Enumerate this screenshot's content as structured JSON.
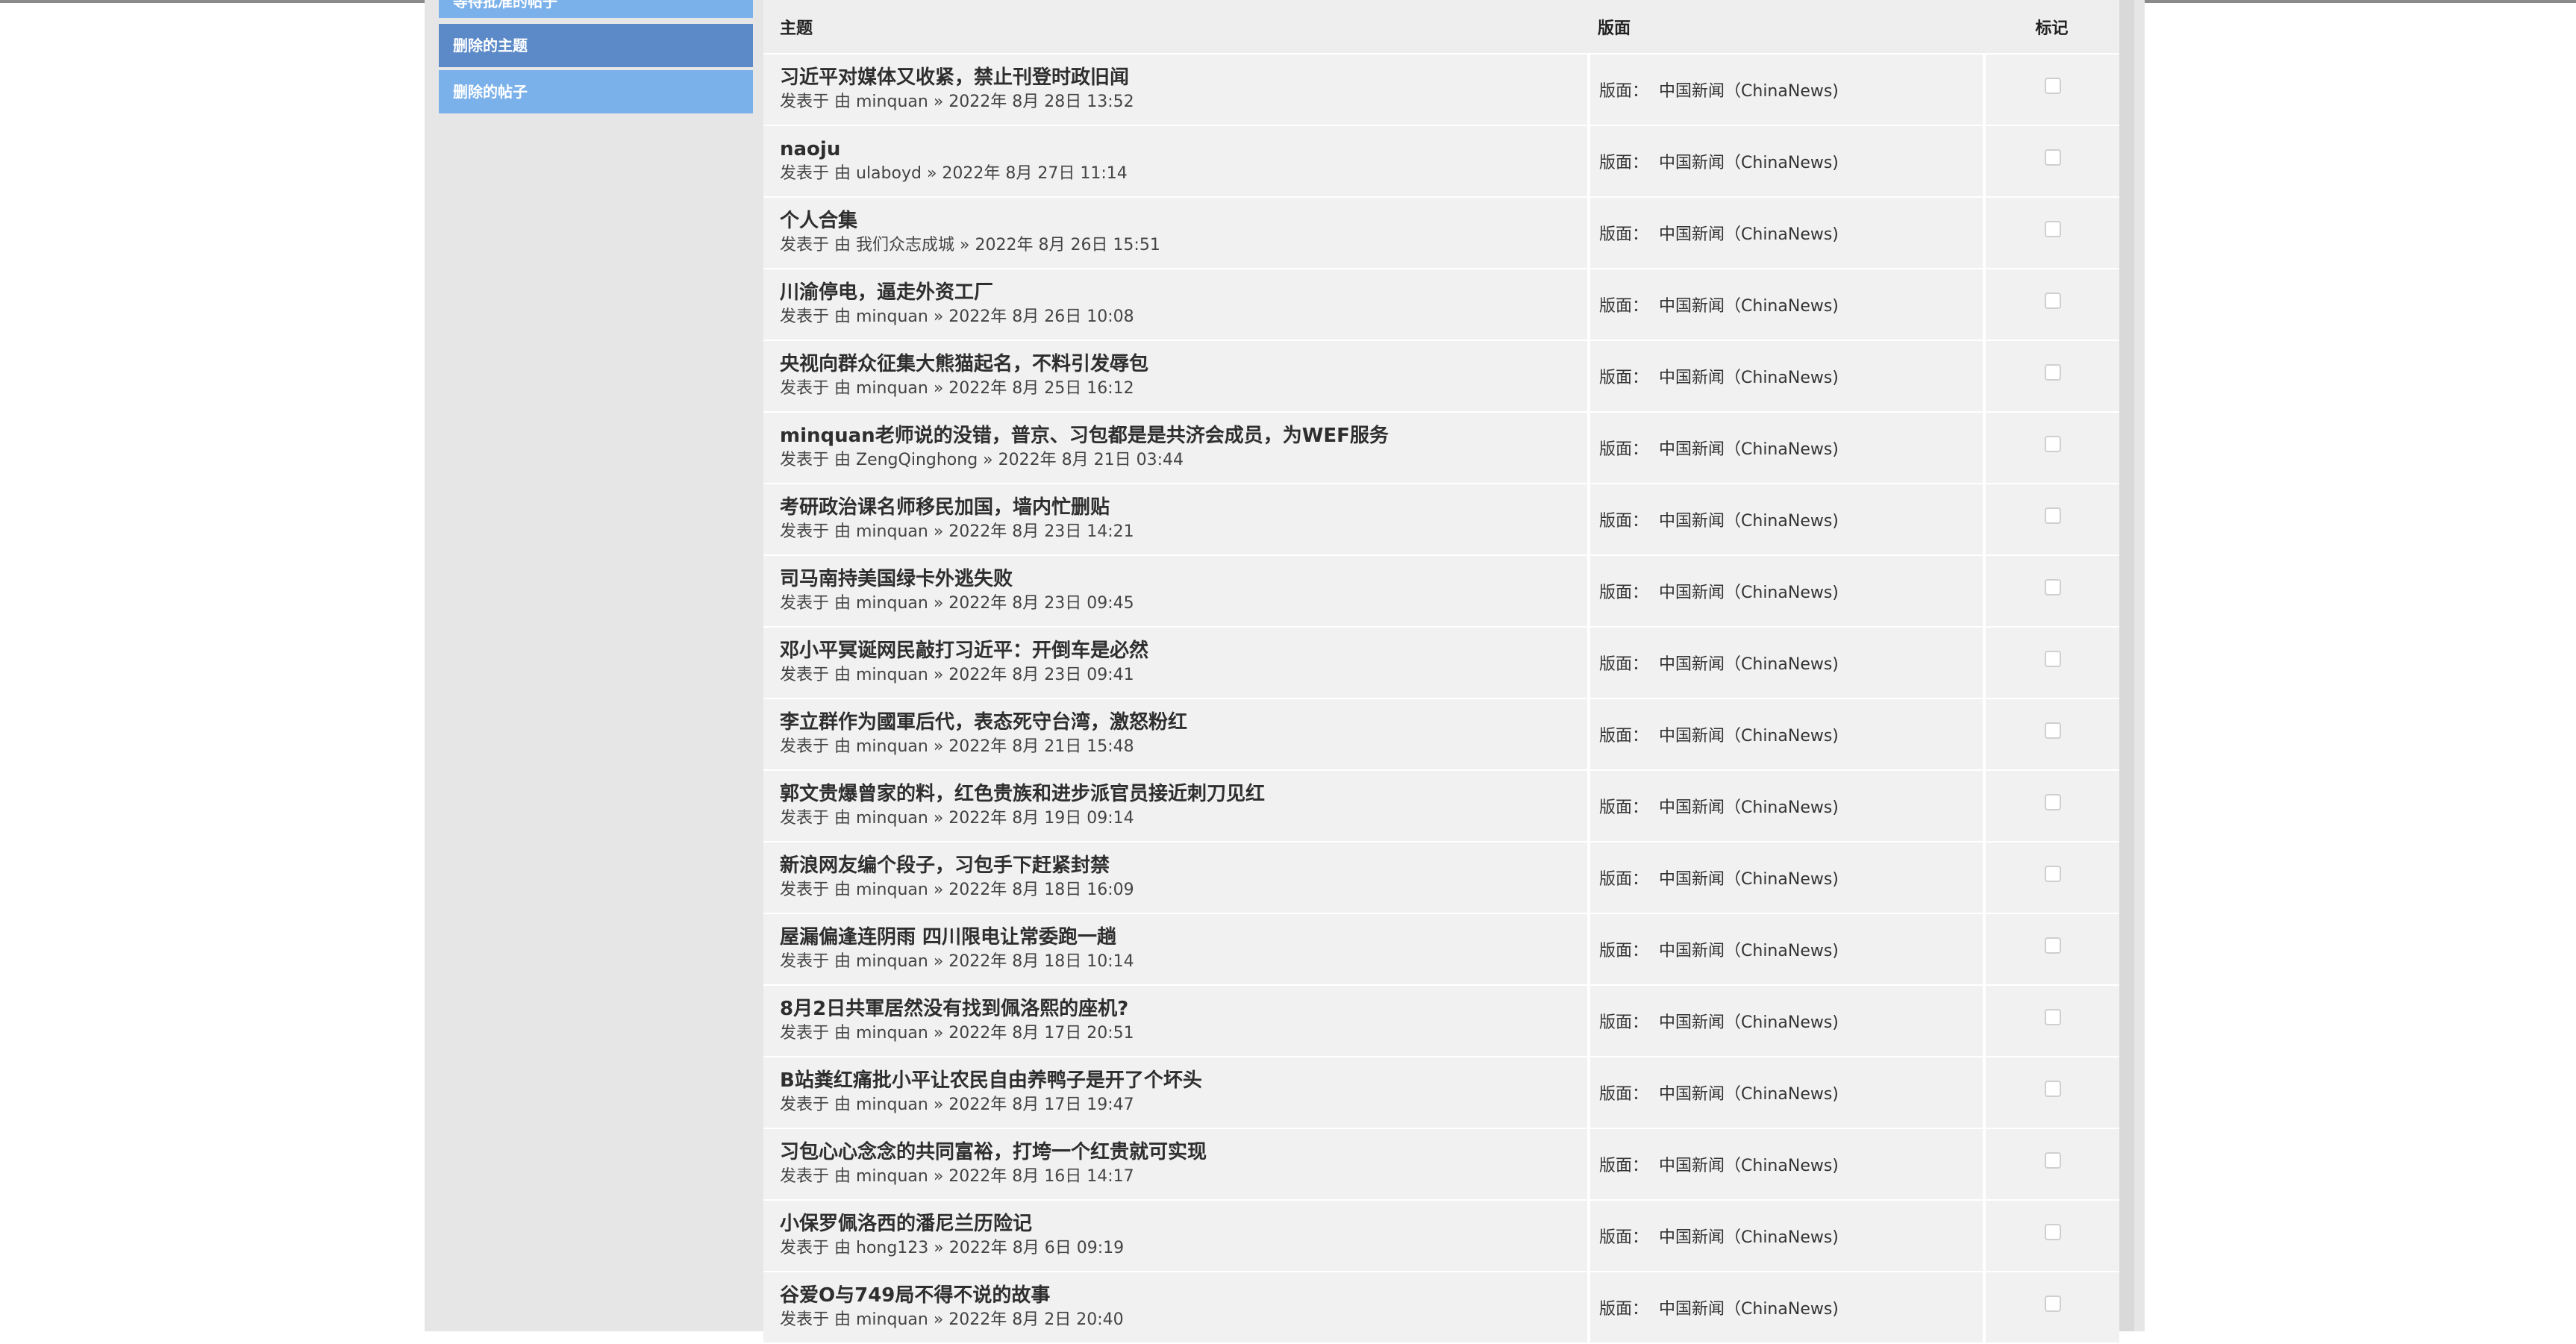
{
  "sidebar": {
    "items": [
      {
        "label": "等待批准的帖子",
        "state": "partial"
      },
      {
        "label": "删除的主题",
        "state": "active"
      },
      {
        "label": "删除的帖子",
        "state": "normal"
      }
    ]
  },
  "table": {
    "headers": {
      "topic": "主题",
      "forum": "版面",
      "mark": "标记"
    },
    "forum_label": "版面：",
    "meta_prefix": "发表于 由",
    "rows": [
      {
        "title": "习近平对媒体又收紧，禁止刊登时政旧闻",
        "author": "minquan",
        "date": "2022年 8月 28日 13:52",
        "forum": "中国新闻（ChinaNews)"
      },
      {
        "title": "naoju",
        "author": "ulaboyd",
        "date": "2022年 8月 27日 11:14",
        "forum": "中国新闻（ChinaNews)"
      },
      {
        "title": "个人合集",
        "author": "我们众志成城",
        "date": "2022年 8月 26日 15:51",
        "forum": "中国新闻（ChinaNews)"
      },
      {
        "title": "川渝停电，逼走外资工厂",
        "author": "minquan",
        "date": "2022年 8月 26日 10:08",
        "forum": "中国新闻（ChinaNews)"
      },
      {
        "title": "央视向群众征集大熊猫起名，不料引发辱包",
        "author": "minquan",
        "date": "2022年 8月 25日 16:12",
        "forum": "中国新闻（ChinaNews)"
      },
      {
        "title": "minquan老师说的没错，普京、习包都是是共济会成员，为WEF服务",
        "author": "ZengQinghong",
        "date": "2022年 8月 21日 03:44",
        "forum": "中国新闻（ChinaNews)"
      },
      {
        "title": "考研政治课名师移民加国，墙内忙删贴",
        "author": "minquan",
        "date": "2022年 8月 23日 14:21",
        "forum": "中国新闻（ChinaNews)"
      },
      {
        "title": "司马南持美国绿卡外逃失败",
        "author": "minquan",
        "date": "2022年 8月 23日 09:45",
        "forum": "中国新闻（ChinaNews)"
      },
      {
        "title": "邓小平冥诞网民敲打习近平：开倒车是必然",
        "author": "minquan",
        "date": "2022年 8月 23日 09:41",
        "forum": "中国新闻（ChinaNews)"
      },
      {
        "title": "李立群作为國軍后代，表态死守台湾，激怒粉红",
        "author": "minquan",
        "date": "2022年 8月 21日 15:48",
        "forum": "中国新闻（ChinaNews)"
      },
      {
        "title": "郭文贵爆曾家的料，红色贵族和进步派官员接近刺刀见红",
        "author": "minquan",
        "date": "2022年 8月 19日 09:14",
        "forum": "中国新闻（ChinaNews)"
      },
      {
        "title": "新浪网友编个段子，习包手下赶紧封禁",
        "author": "minquan",
        "date": "2022年 8月 18日 16:09",
        "forum": "中国新闻（ChinaNews)"
      },
      {
        "title": "屋漏偏逢连阴雨 四川限电让常委跑一趟",
        "author": "minquan",
        "date": "2022年 8月 18日 10:14",
        "forum": "中国新闻（ChinaNews)"
      },
      {
        "title": "8月2日共軍居然没有找到佩洛熙的座机?",
        "author": "minquan",
        "date": "2022年 8月 17日 20:51",
        "forum": "中国新闻（ChinaNews)"
      },
      {
        "title": "B站粪红痛批小平让农民自由养鸭子是开了个坏头",
        "author": "minquan",
        "date": "2022年 8月 17日 19:47",
        "forum": "中国新闻（ChinaNews)"
      },
      {
        "title": "习包心心念念的共同富裕，打垮一个红贵就可实现",
        "author": "minquan",
        "date": "2022年 8月 16日 14:17",
        "forum": "中国新闻（ChinaNews)"
      },
      {
        "title": "小保罗佩洛西的潘尼兰历险记",
        "author": "hong123",
        "date": "2022年 8月 6日 09:19",
        "forum": "中国新闻（ChinaNews)"
      },
      {
        "title": "谷爱O与749局不得不说的故事",
        "author": "minquan",
        "date": "2022年 8月 2日 20:40",
        "forum": "中国新闻（ChinaNews)"
      }
    ]
  }
}
